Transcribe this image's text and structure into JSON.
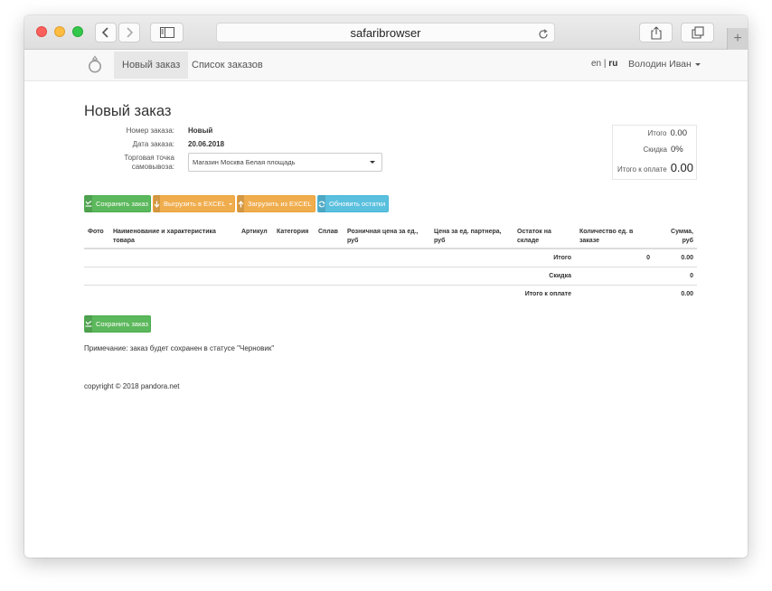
{
  "browser": {
    "address": "safaribrowser",
    "new_tab_symbol": "+"
  },
  "navbar": {
    "items": [
      {
        "label": "Новый заказ",
        "active": true
      },
      {
        "label": "Список заказов",
        "active": false
      }
    ],
    "lang_en": "en",
    "lang_sep": "|",
    "lang_ru": "ru",
    "user": "Володин Иван"
  },
  "page": {
    "title": "Новый заказ",
    "order_number_label": "Номер заказа:",
    "order_number_value": "Новый",
    "order_date_label": "Дата заказа:",
    "order_date_value": "20.06.2018",
    "pickup_label_line1": "Торговая точка",
    "pickup_label_line2": "самовывоза:",
    "pickup_value": "Магазин Москва Белая площадь"
  },
  "totals": {
    "total_label": "Итого",
    "total_value": "0.00",
    "discount_label": "Скидка",
    "discount_value": "0%",
    "payable_label": "Итого к оплате",
    "payable_value": "0.00"
  },
  "buttons": {
    "save": "Сохранить заказ",
    "export_excel": "Выгрузить в EXCEL",
    "import_excel": "Загрузить из EXCEL",
    "refresh_stock": "Обновить остатки",
    "save_bottom": "Сохранить заказ"
  },
  "table": {
    "columns": {
      "photo": "Фото",
      "name_line1": "Наименование и характеристика",
      "name_line2": "товара",
      "article": "Артикул",
      "category": "Категория",
      "alloy": "Сплав",
      "retail_line1": "Розничная цена за ед.,",
      "retail_line2": "руб",
      "partner_line1": "Цена за ед. партнера,",
      "partner_line2": "руб",
      "stock_line1": "Остаток на",
      "stock_line2": "складе",
      "qty_line1": "Количество ед. в",
      "qty_line2": "заказе",
      "sum_line1": "Сумма,",
      "sum_line2": "руб"
    },
    "summary": [
      {
        "label": "Итого",
        "qty": "0",
        "sum": "0.00"
      },
      {
        "label": "Скидка",
        "qty": "",
        "sum": "0"
      },
      {
        "label": "Итого к оплате",
        "qty": "",
        "sum": "0.00"
      }
    ]
  },
  "note": "Примечание: заказ будет сохранен в статусе \"Черновик\"",
  "footer": "copyright © 2018 pandora.net",
  "colors": {
    "green": "#5cb85c",
    "orange": "#f0ad4e",
    "blue": "#5bc0de"
  }
}
